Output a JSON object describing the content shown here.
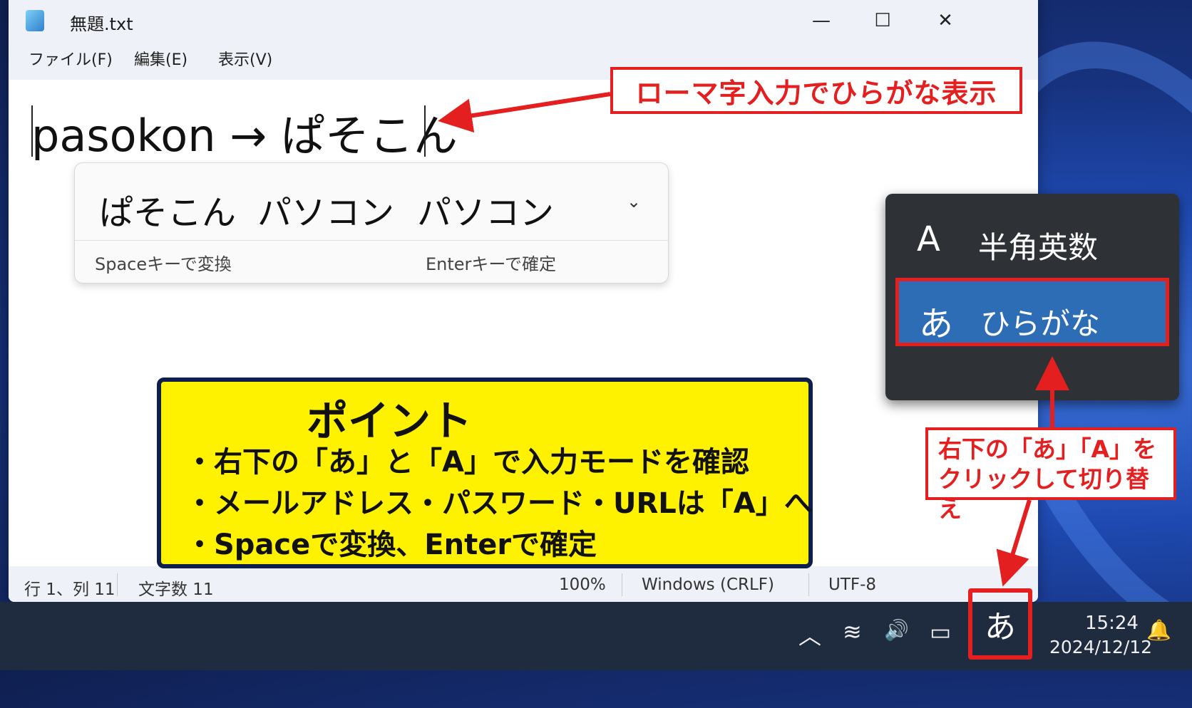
{
  "window": {
    "title": "無題.txt",
    "minimize_glyph": "—",
    "maximize_glyph": "☐",
    "close_glyph": "✕",
    "icon": "notepad-icon"
  },
  "menu": [
    "ファイル(F)",
    "編集(E)",
    "表示(V)"
  ],
  "editor": {
    "text": "pasokon → ぱそこん"
  },
  "ime_candidates": {
    "items": [
      "ぱそこん",
      "パソコン",
      "パソコン"
    ],
    "expand_glyph": "⌄",
    "hint_convert": "Spaceキーで変換",
    "hint_confirm": "Enterキーで確定"
  },
  "statusbar": {
    "position": "行 1、列 11",
    "char_count": "文字数 11",
    "zoom": "100%",
    "line_ending": "Windows (CRLF)",
    "encoding": "UTF-8"
  },
  "annotations": {
    "top_callout": "ローマ字入力でひらがな表示",
    "point_title": "ポイント",
    "point_lines": [
      "・右下の「あ」と「A」で入力モードを確認",
      "・メールアドレス・パスワード・URLは「A」へ",
      "・Spaceで変換、Enterで確定"
    ],
    "br_callout_line1": "右下の「あ」「A」を",
    "br_callout_line2": "クリックして切り替え",
    "accent_color": "#e41f1f",
    "point_bg_color": "#fff200"
  },
  "ime_menu": {
    "options": [
      {
        "glyph": "A",
        "label": "半角英数"
      },
      {
        "glyph": "あ",
        "label": "ひらがな"
      }
    ],
    "selected_color": "#2d6db5"
  },
  "taskbar": {
    "tray_icons": [
      "chevron-up-icon",
      "wifi-icon",
      "volume-icon",
      "battery-icon"
    ],
    "chevron_glyph": "︿",
    "wifi_glyph": "≋",
    "volume_glyph": "🔊",
    "battery_glyph": "▭",
    "ime_indicator": "あ",
    "time": "15:24",
    "date": "2024/12/12",
    "bell_glyph": "🔔"
  }
}
